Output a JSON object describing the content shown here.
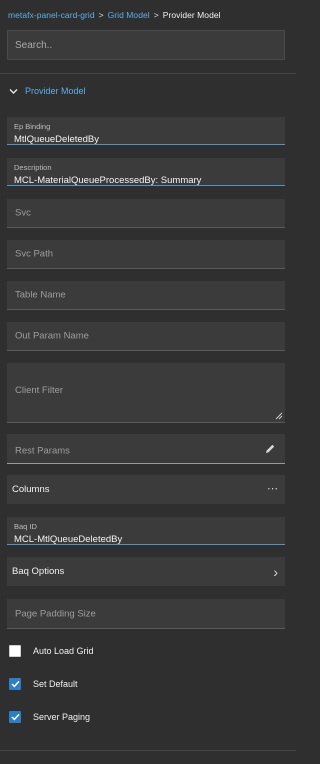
{
  "breadcrumb": {
    "items": [
      "metafx-panel-card-grid",
      "Grid Model",
      "Provider Model"
    ],
    "separator": ">"
  },
  "search": {
    "placeholder": "Search.."
  },
  "section": {
    "title": "Provider Model",
    "expanded": true
  },
  "fields": {
    "ep_binding": {
      "label": "Ep Binding",
      "value": "MtlQueueDeletedBy"
    },
    "description": {
      "label": "Description",
      "value": "MCL-MaterialQueueProcessedBy: Summary"
    },
    "svc": {
      "placeholder": "Svc"
    },
    "svc_path": {
      "placeholder": "Svc Path"
    },
    "table_name": {
      "placeholder": "Table Name"
    },
    "out_param_name": {
      "placeholder": "Out Param Name"
    },
    "client_filter": {
      "placeholder": "Client Filter"
    },
    "rest_params": {
      "placeholder": "Rest Params"
    },
    "baq_id": {
      "label": "Baq ID",
      "value": "MCL-MtlQueueDeletedBy"
    },
    "page_padding_size": {
      "placeholder": "Page Padding Size"
    }
  },
  "columns": {
    "label": "Columns",
    "icon": "ellipsis-icon",
    "icon_text": "⋯"
  },
  "baq_options": {
    "label": "Baq Options",
    "icon": "chevron-right-icon",
    "icon_text": "›"
  },
  "checkboxes": [
    {
      "label": "Auto Load Grid",
      "checked": false
    },
    {
      "label": "Set Default",
      "checked": true
    },
    {
      "label": "Server Paging",
      "checked": true
    }
  ],
  "colors": {
    "background": "#2f2f2f",
    "field_background": "#3b3b3b",
    "accent": "#5fb0e8",
    "checkbox_checked": "#2a7fc8"
  }
}
